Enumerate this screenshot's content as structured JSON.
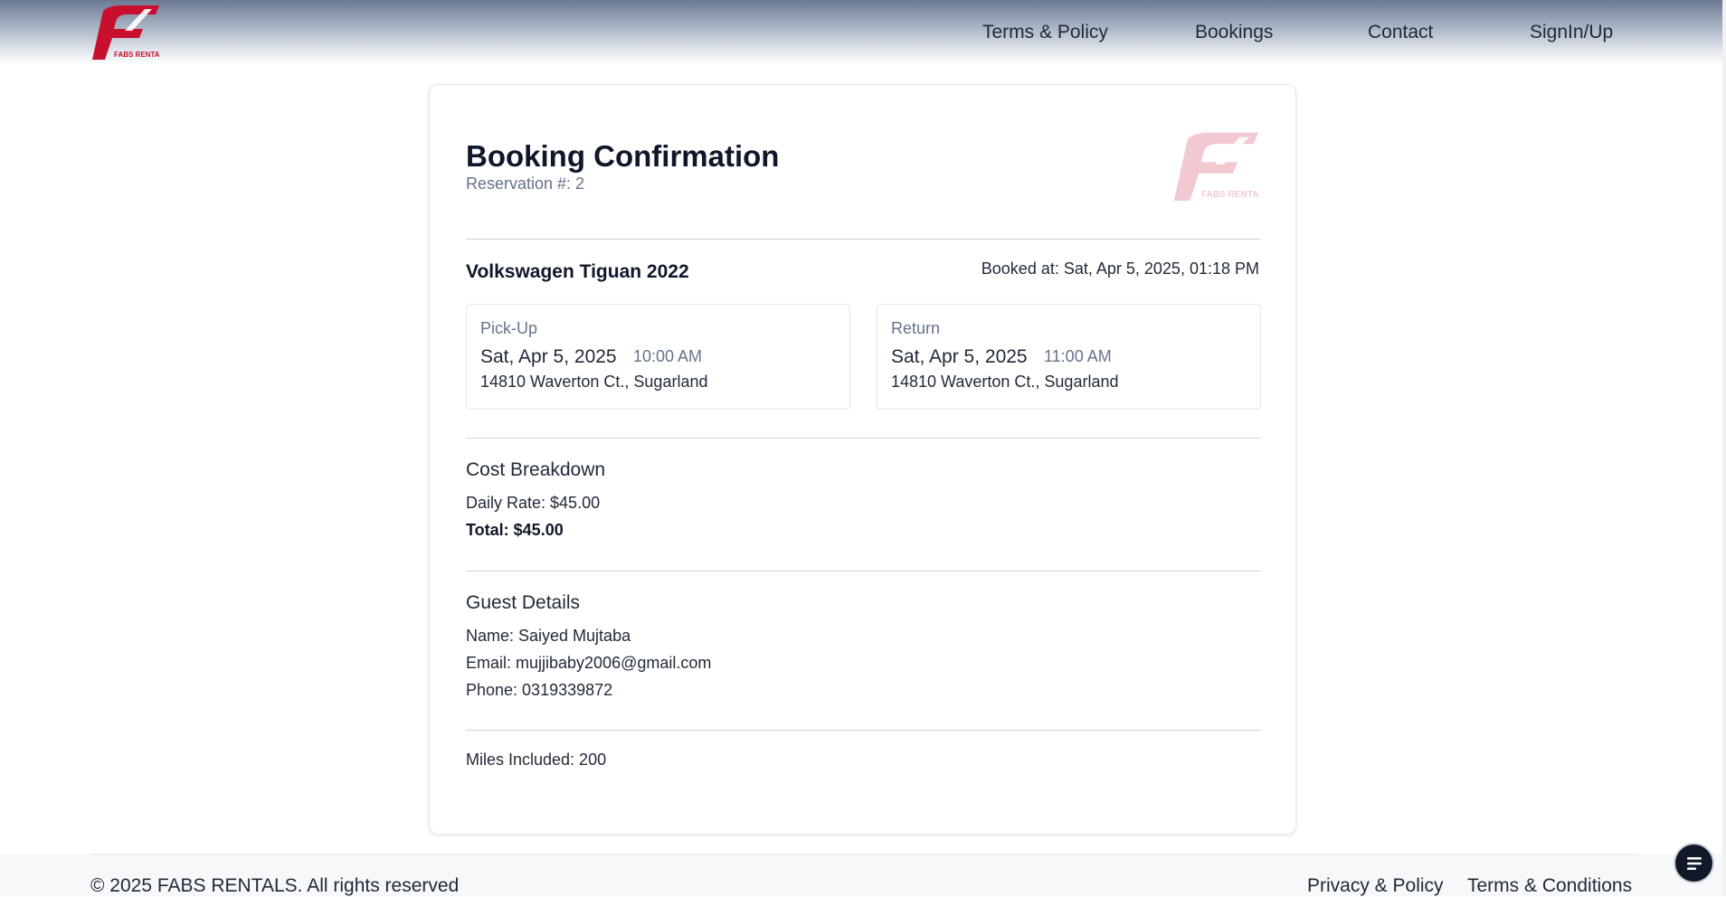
{
  "header": {
    "logo_text": "FABS RENTALS",
    "nav": [
      {
        "label": "Terms & Policy"
      },
      {
        "label": "Bookings"
      },
      {
        "label": "Contact"
      },
      {
        "label": "SignIn/Up"
      }
    ]
  },
  "booking": {
    "title": "Booking Confirmation",
    "reservation": "Reservation #: 2",
    "vehicle": "Volkswagen Tiguan 2022",
    "booked_at": "Booked at: Sat, Apr 5, 2025, 01:18 PM",
    "pickup": {
      "label": "Pick-Up",
      "date": "Sat, Apr 5, 2025",
      "time": "10:00 AM",
      "address": "14810 Waverton Ct., Sugarland"
    },
    "return": {
      "label": "Return",
      "date": "Sat, Apr 5, 2025",
      "time": "11:00 AM",
      "address": "14810 Waverton Ct., Sugarland"
    },
    "cost": {
      "title": "Cost Breakdown",
      "daily_rate": "Daily Rate: $45.00",
      "total": "Total: $45.00"
    },
    "guest": {
      "title": "Guest Details",
      "name": "Name: Saiyed Mujtaba",
      "email": "Email: mujjibaby2006@gmail.com",
      "phone": "Phone: 0319339872"
    },
    "miles": "Miles Included: 200"
  },
  "footer": {
    "copyright": "© 2025 FABS RENTALS. All rights reserved",
    "links": [
      {
        "label": "Privacy & Policy"
      },
      {
        "label": "Terms & Conditions"
      }
    ]
  },
  "colors": {
    "brand": "#c8102e",
    "header_top": "#6b7a93",
    "text": "#1f2937",
    "muted": "#64748b"
  },
  "icons": {
    "chat": "chat-menu-icon"
  }
}
